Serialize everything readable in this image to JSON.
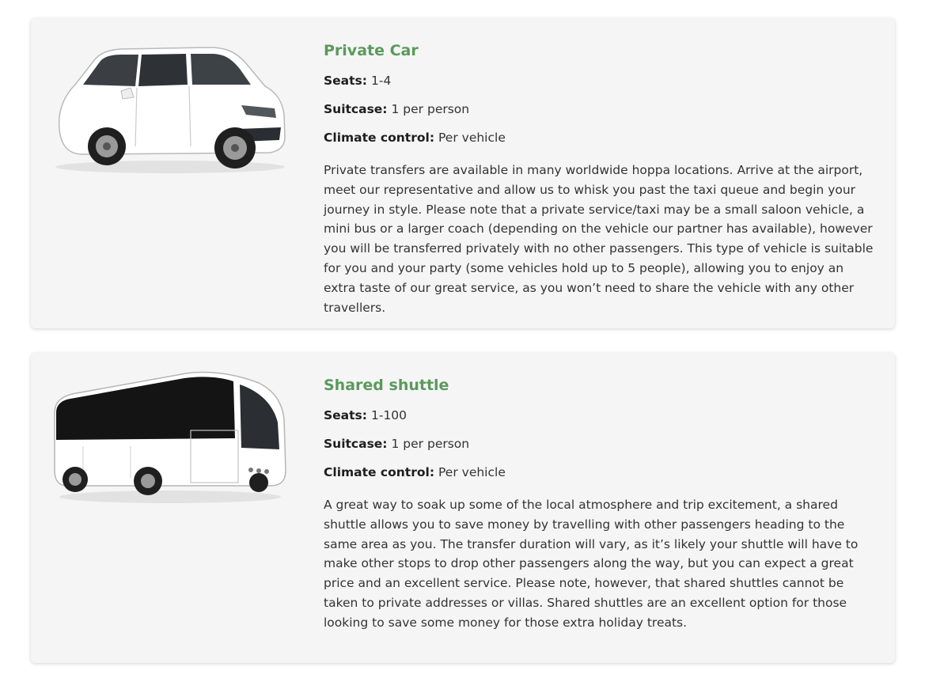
{
  "cards": [
    {
      "title": "Private Car",
      "image_name": "private-car-image",
      "seats_label": "Seats:",
      "seats_value": "1-4",
      "suitcase_label": "Suitcase:",
      "suitcase_value": "1 per person",
      "climate_label": "Climate control:",
      "climate_value": "Per vehicle",
      "description": "Private transfers are available in many worldwide hoppa locations. Arrive at the airport, meet our representative and allow us to whisk you past the taxi queue and begin your journey in style. Please note that a private service/taxi may be a small saloon vehicle, a mini bus or a larger coach (depending on the vehicle our partner has available), however you will be transferred privately with no other passengers. This type of vehicle is suitable for you and your party (some vehicles hold up to 5 people), allowing you to enjoy an extra taste of our great service, as you won’t need to share the vehicle with any other travellers."
    },
    {
      "title": "Shared shuttle",
      "image_name": "shared-shuttle-image",
      "seats_label": "Seats:",
      "seats_value": "1-100",
      "suitcase_label": "Suitcase:",
      "suitcase_value": "1 per person",
      "climate_label": "Climate control:",
      "climate_value": "Per vehicle",
      "description": "A great way to soak up some of the local atmosphere and trip excitement, a shared shuttle allows you to save money by travelling with other passengers heading to the same area as you. The transfer duration will vary, as it’s likely your shuttle will have to make other stops to drop other passengers along the way, but you can expect a great price and an excellent service. Please note, however, that shared shuttles cannot be taken to private addresses or villas. Shared shuttles are an excellent option for those looking to save some money for those extra holiday treats."
    }
  ],
  "colors": {
    "title": "#5a9a5c",
    "card_bg": "#f5f5f5",
    "text": "#333333"
  }
}
